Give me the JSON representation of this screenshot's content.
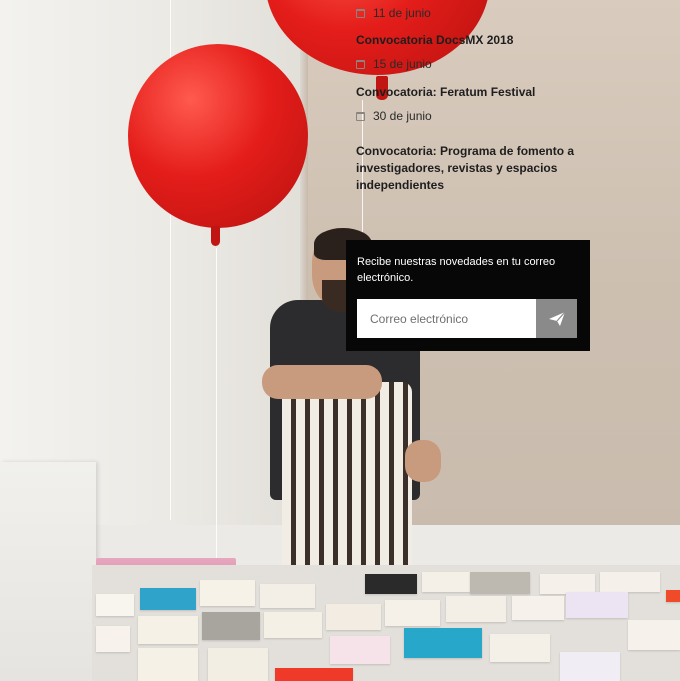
{
  "events": [
    {
      "date": "11 de junio",
      "title": "Convocatoria DocsMX 2018"
    },
    {
      "date": "15 de junio",
      "title": "Convocatoria: Feratum Festival"
    },
    {
      "date": "30 de junio",
      "title": "Convocatoria: Programa de fomento a investigadores, revistas y espacios independientes"
    }
  ],
  "newsletter": {
    "text": "Recibe nuestras novedades en tu correo electrónico.",
    "email_placeholder": "Correo electrónico",
    "submit_icon": "paper-plane-icon"
  },
  "colors": {
    "newsletter_bg": "#070707",
    "submit_bg": "#8a8a8a",
    "balloon": "#e41d1a"
  }
}
